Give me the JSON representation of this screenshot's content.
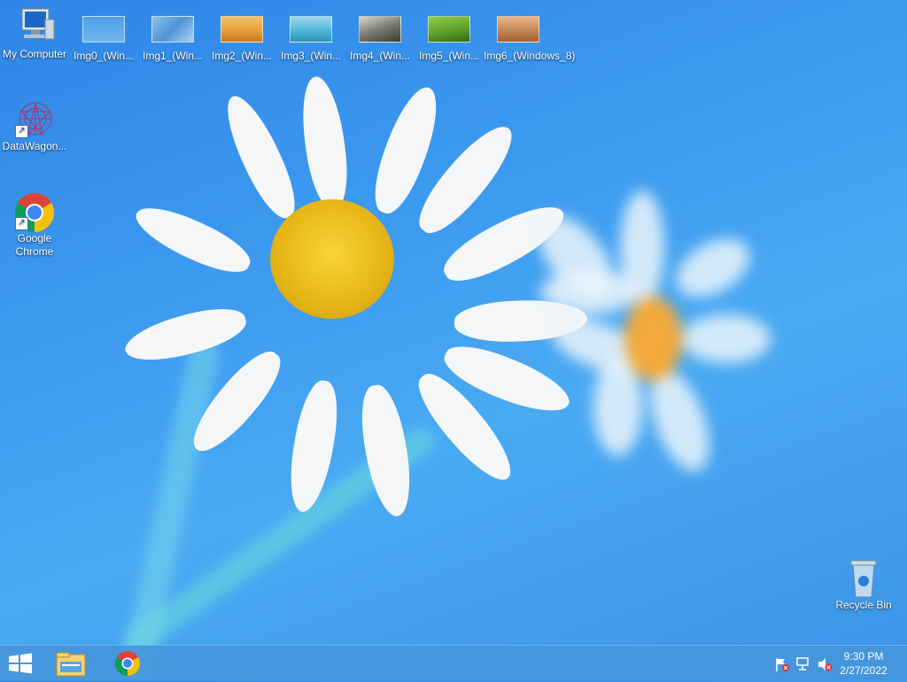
{
  "desktop": {
    "icons": [
      {
        "label": "My Computer",
        "icon": "computer-icon"
      },
      {
        "label": "Img0_(Win...",
        "icon": "image-thumbnail-icon"
      },
      {
        "label": "Img1_(Win...",
        "icon": "image-thumbnail-icon"
      },
      {
        "label": "Img2_(Win...",
        "icon": "image-thumbnail-icon"
      },
      {
        "label": "Img3_(Win...",
        "icon": "image-thumbnail-icon"
      },
      {
        "label": "Img4_(Win...",
        "icon": "image-thumbnail-icon"
      },
      {
        "label": "Img5_(Win...",
        "icon": "image-thumbnail-icon"
      },
      {
        "label": "Img6_(Windows_8)",
        "icon": "image-thumbnail-icon"
      },
      {
        "label": "DataWagon...",
        "icon": "datawagon-icon"
      },
      {
        "label": "Google Chrome",
        "icon": "chrome-icon"
      },
      {
        "label": "Recycle Bin",
        "icon": "recycle-bin-icon"
      }
    ]
  },
  "taskbar": {
    "start_icon": "windows-logo-icon",
    "pinned": [
      {
        "name": "File Explorer",
        "icon": "file-explorer-icon"
      },
      {
        "name": "Google Chrome",
        "icon": "chrome-icon"
      }
    ],
    "tray_icons": [
      "action-center-flag-icon",
      "network-icon",
      "volume-muted-icon"
    ],
    "time": "9:30 PM",
    "date": "2/27/2022"
  },
  "colors": {
    "background": "#3c9af0",
    "taskbar": "#4696dc",
    "thumb_colors": [
      "#4f9fe8",
      "#8ec3ec",
      "#e8a33c",
      "#48b6d8",
      "#7a7a70",
      "#5a9a2a",
      "#c88a58"
    ]
  }
}
